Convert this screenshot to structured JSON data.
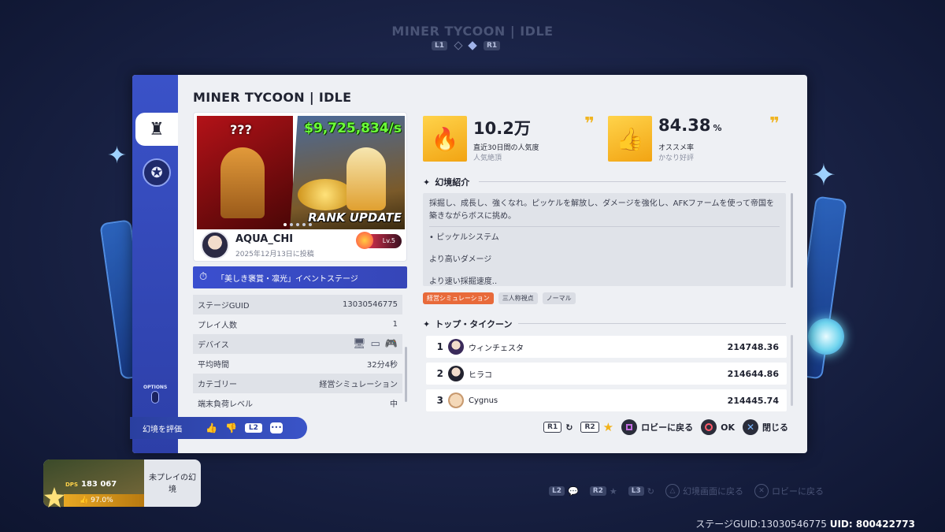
{
  "background": {
    "title": "MINER TYCOON | IDLE",
    "nav_left": "L1",
    "nav_right": "R1"
  },
  "panel": {
    "title": "MINER TYCOON | IDLE",
    "sidebar": {
      "tabs": [
        {
          "icon": "chess-rook-icon",
          "active": true
        },
        {
          "icon": "medal-icon",
          "active": false
        }
      ],
      "options_label": "OPTIONS"
    },
    "thumbnail": {
      "question_marks": "???",
      "money": "$9,725,834/s",
      "rank_text": "RANK UPDATE",
      "slide_count": 5,
      "active_slide": 0
    },
    "author": {
      "name": "AQUA_CHI",
      "date": "2025年12月13日に投稿",
      "level": "Lv.5"
    },
    "event": {
      "label": "「美しき褒賞・凛光」イベントステージ"
    },
    "info_rows": [
      {
        "label": "ステージGUID",
        "value": "13030546775"
      },
      {
        "label": "プレイ人数",
        "value": "1"
      },
      {
        "label": "デバイス",
        "value": ""
      },
      {
        "label": "平均時間",
        "value": "32分4秒"
      },
      {
        "label": "カテゴリー",
        "value": "経営シミュレーション"
      },
      {
        "label": "端末負荷レベル",
        "value": "中"
      }
    ],
    "stats": [
      {
        "number": "10.2万",
        "unit": "",
        "label": "直近30日間の人気度",
        "sub": "人気絶頂",
        "icon": "flame-icon"
      },
      {
        "number": "84.38",
        "unit": "%",
        "label": "オススメ率",
        "sub": "かなり好評",
        "icon": "thumbs-up-icon"
      }
    ],
    "intro": {
      "header": "幻境紹介",
      "text": "採掘し、成長し、強くなれ。ピッケルを解放し、ダメージを強化し、AFKファームを使って帝国を築きながらボスに挑め。",
      "lines": [
        "• ピッケルシステム",
        "より高いダメージ",
        "より速い採掘速度.."
      ]
    },
    "tags": [
      {
        "label": "経営シミュレーション",
        "hot": true
      },
      {
        "label": "三人称視点",
        "hot": false
      },
      {
        "label": "ノーマル",
        "hot": false
      }
    ],
    "ranking": {
      "header": "トップ・タイクーン",
      "rows": [
        {
          "rank": "1",
          "name": "ウィンチェスタ",
          "score": "214748.36"
        },
        {
          "rank": "2",
          "name": "ヒラコ",
          "score": "214644.86"
        },
        {
          "rank": "3",
          "name": "Cygnus",
          "score": "214445.74"
        }
      ]
    },
    "rate": {
      "label": "幻境を評価",
      "key": "L2"
    },
    "actions": {
      "refresh_key": "R1",
      "fav_key": "R2",
      "lobby_label": "ロビーに戻る",
      "ok_label": "OK",
      "close_label": "閉じる"
    }
  },
  "mini_card": {
    "dps_label": "DPS",
    "dps_value": "183 067",
    "rate": "97.0%",
    "text": "未プレイの幻境"
  },
  "bottom_nav": {
    "l2": "L2",
    "r2": "R2",
    "l3": "L3",
    "back_view": "幻境画面に戻る",
    "back_lobby": "ロビーに戻る"
  },
  "footer": {
    "guid": "ステージGUID:13030546775",
    "uid": "UID: 800422773"
  }
}
